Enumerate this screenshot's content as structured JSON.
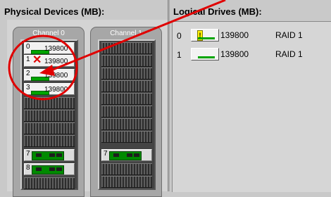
{
  "headings": {
    "physical": "Physical Devices (MB):",
    "logical": "Logical Drives (MB):"
  },
  "channels": [
    {
      "title": "Channel 0",
      "drives": [
        {
          "num": "0",
          "capacity": "139800",
          "status": "online"
        },
        {
          "num": "1",
          "capacity": "139800",
          "status": "failed"
        },
        {
          "num": "2",
          "capacity": "139800",
          "status": "online"
        },
        {
          "num": "3",
          "capacity": "139800",
          "status": "online"
        }
      ],
      "cards": [
        {
          "num": "7"
        },
        {
          "num": "8"
        }
      ]
    },
    {
      "title": "Channel 1",
      "cards": [
        {
          "num": "7"
        }
      ]
    }
  ],
  "logical_drives": [
    {
      "num": "0",
      "capacity": "139800",
      "raid": "RAID 1",
      "state": "critical",
      "warn_symbol": "!"
    },
    {
      "num": "1",
      "capacity": "139800",
      "raid": "RAID 1",
      "state": "online"
    }
  ],
  "colors": {
    "annotation": "#e00000",
    "led_green": "#00a500"
  },
  "annotation": {
    "shape": "circle",
    "arrow_direction": "from logical drive 0 to failed physical drive 1"
  }
}
